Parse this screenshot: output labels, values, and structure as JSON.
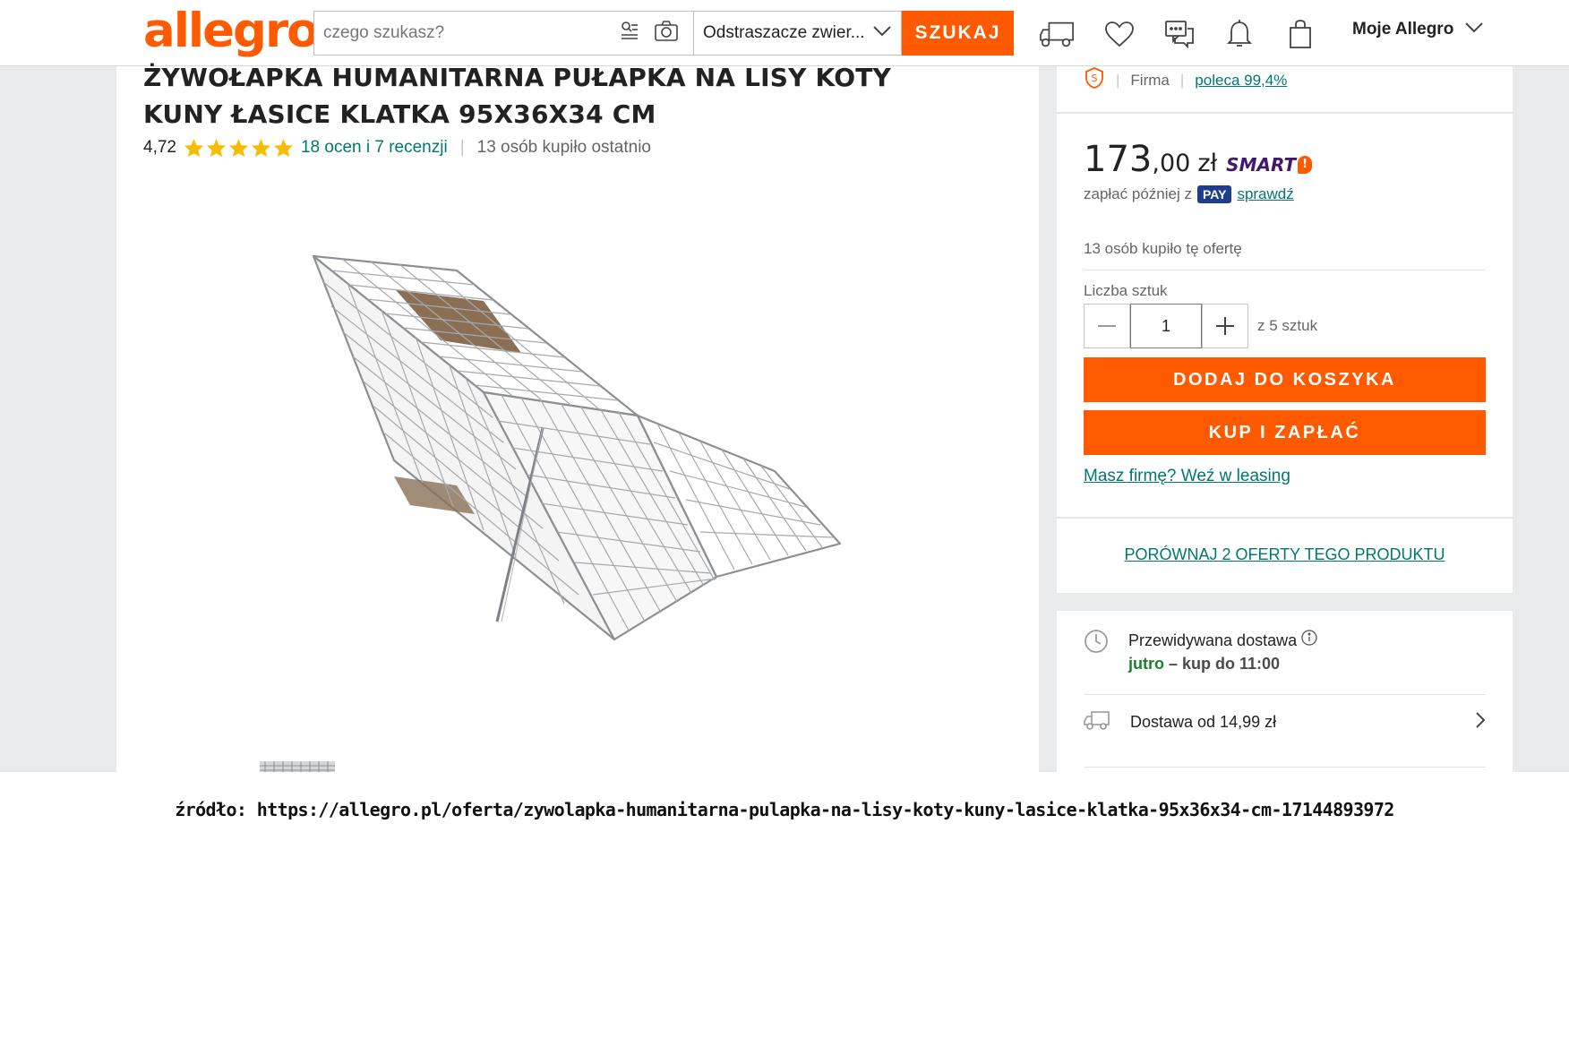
{
  "header": {
    "logo": "allegro",
    "search_placeholder": "czego szukasz?",
    "category": "Odstraszacze zwier...",
    "search_button": "SZUKAJ",
    "account": "Moje Allegro"
  },
  "product": {
    "title": "ŻYWOŁAPKA HUMANITARNA PUŁAPKA NA LISY KOTY KUNY ŁASICE KLATKA 95X36X34 CM",
    "rating": "4,72",
    "stars": 5,
    "reviews_link": "18 ocen i 7 recenzji",
    "bought_recently": "13 osób kupiło ostatnio"
  },
  "seller": {
    "type": "Firma",
    "recommend": "poleca 99,4%"
  },
  "buy": {
    "price_int": "173",
    "price_dec": ",00",
    "currency": "zł",
    "smart_label": "SMART",
    "pay_later_text": "zapłać później z",
    "pay_badge": "PAY",
    "check_link": "sprawdź",
    "bought_offer": "13 osób kupiło tę ofertę",
    "qty_label": "Liczba sztuk",
    "qty_value": "1",
    "qty_of": "z 5 sztuk",
    "add_to_cart": "DODAJ DO KOSZYKA",
    "buy_now": "KUP I ZAPŁAĆ",
    "leasing_link": "Masz firmę? Weź w leasing"
  },
  "compare": {
    "link": "PORÓWNAJ 2 OFERTY TEGO PRODUKTU"
  },
  "delivery": {
    "expected_label": "Przewidywana dostawa",
    "when_day": "jutro",
    "when_rest": "– kup do 11:00",
    "cost": "Dostawa od 14,99 zł"
  },
  "caption": {
    "prefix": "źródło:",
    "url": "https://allegro.pl/oferta/zywolapka-humanitarna-pulapka-na-lisy-koty-kuny-lasice-klatka-95x36x34-cm-17144893972"
  },
  "colors": {
    "accent": "#ff5a00",
    "link": "#00796b",
    "smart": "#3f1a6b",
    "pay": "#1d3d8f",
    "delivery_green": "#1a7f2e"
  }
}
